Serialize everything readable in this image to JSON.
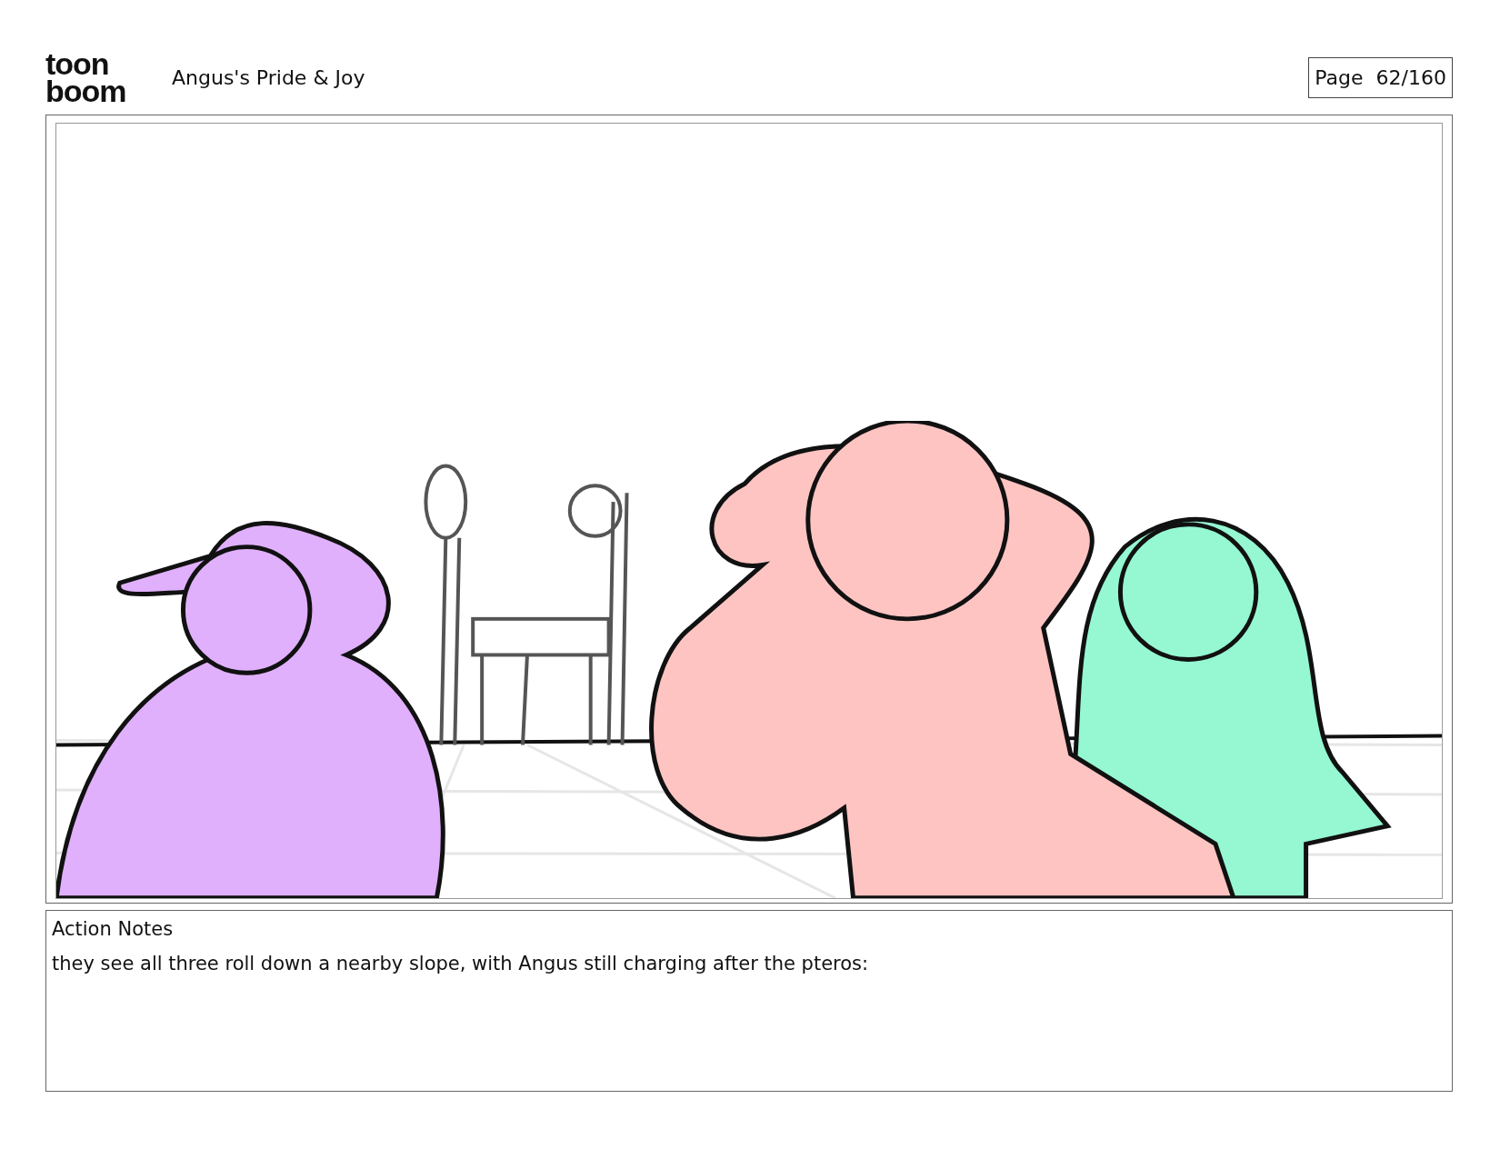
{
  "logo": {
    "line_1": "toon",
    "line_2": "boom"
  },
  "project_title": "Angus's Pride & Joy",
  "page_label": "Page  62/160",
  "notes": {
    "heading": "Action Notes",
    "text": "they see all three roll down a nearby slope, with Angus still charging after the pteros:"
  }
}
